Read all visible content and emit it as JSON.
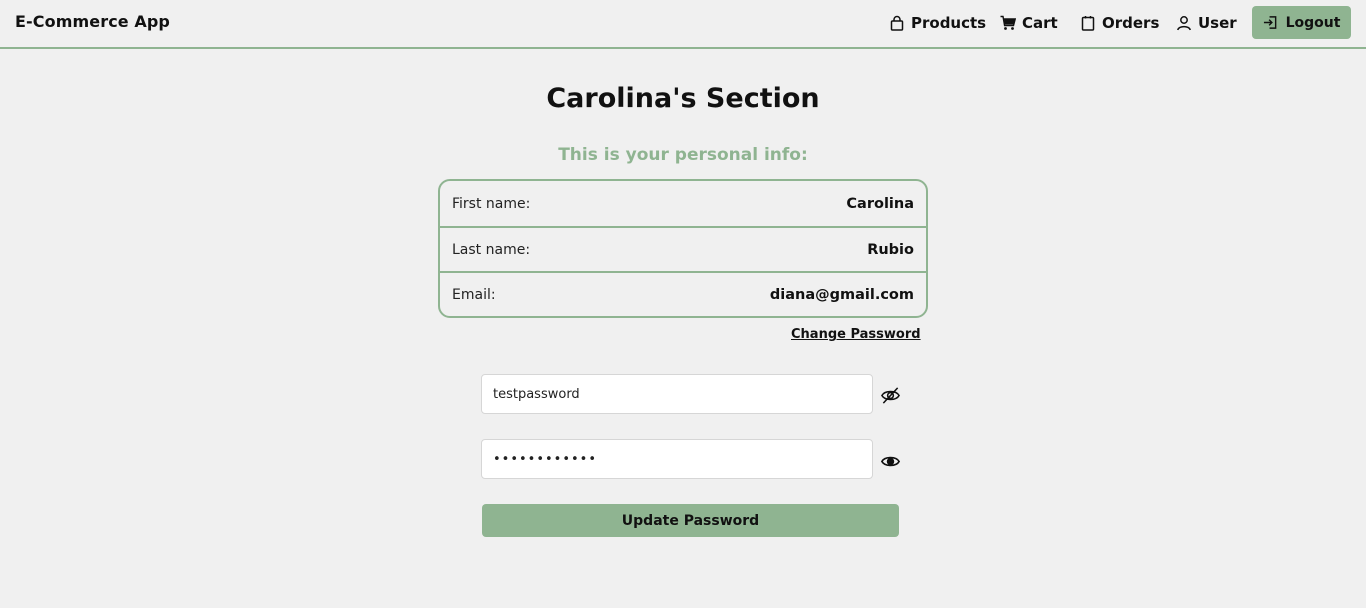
{
  "app": {
    "brand": "E-Commerce App"
  },
  "nav": {
    "products": "Products",
    "cart": "Cart",
    "orders": "Orders",
    "user": "User",
    "logout": "Logout",
    "accent_color": "#8fb491"
  },
  "main": {
    "title": "Carolina's Section",
    "subtitle": "This is your personal info:",
    "info": [
      {
        "label": "First name:",
        "value": "Carolina"
      },
      {
        "label": "Last name:",
        "value": "Rubio"
      },
      {
        "label": "Email:",
        "value": "diana@gmail.com"
      }
    ],
    "change_password_link": "Change Password",
    "password_field_1": {
      "value": "testpassword",
      "icon": "eye-off-icon"
    },
    "password_field_2": {
      "value": "••••••••••••",
      "icon": "eye-icon"
    },
    "update_button": "Update Password"
  }
}
